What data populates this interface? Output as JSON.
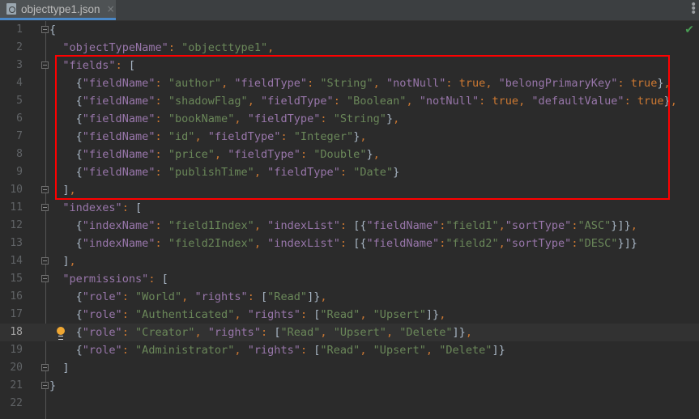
{
  "tab": {
    "filename": "objecttype1.json",
    "close": "×",
    "icon": "json-file-icon"
  },
  "toolbar": {
    "menu_icon": "more-vertical-icon",
    "status_icon": "check-icon"
  },
  "current_line": 18,
  "fold_lines": [
    1,
    3,
    10,
    11,
    14,
    15,
    20,
    21
  ],
  "bulb_line": 18,
  "highlight": {
    "label": "fields",
    "color": "#ff0000"
  },
  "lines": [
    [
      [
        "br",
        "{"
      ]
    ],
    [
      [
        "sp",
        "  "
      ],
      [
        "key",
        "\"objectTypeName\""
      ],
      [
        "punc",
        ": "
      ],
      [
        "str",
        "\"objecttype1\""
      ],
      [
        "punc",
        ","
      ]
    ],
    [
      [
        "sp",
        "  "
      ],
      [
        "key",
        "\"fields\""
      ],
      [
        "punc",
        ": "
      ],
      [
        "br",
        "["
      ]
    ],
    [
      [
        "sp",
        "    "
      ],
      [
        "br",
        "{"
      ],
      [
        "key",
        "\"fieldName\""
      ],
      [
        "punc",
        ": "
      ],
      [
        "str",
        "\"author\""
      ],
      [
        "punc",
        ", "
      ],
      [
        "key",
        "\"fieldType\""
      ],
      [
        "punc",
        ": "
      ],
      [
        "str",
        "\"String\""
      ],
      [
        "punc",
        ", "
      ],
      [
        "key",
        "\"notNull\""
      ],
      [
        "punc",
        ": "
      ],
      [
        "kw",
        "true"
      ],
      [
        "punc",
        ", "
      ],
      [
        "key",
        "\"belongPrimaryKey\""
      ],
      [
        "punc",
        ": "
      ],
      [
        "kw",
        "true"
      ],
      [
        "br",
        "}"
      ],
      [
        "punc",
        ","
      ]
    ],
    [
      [
        "sp",
        "    "
      ],
      [
        "br",
        "{"
      ],
      [
        "key",
        "\"fieldName\""
      ],
      [
        "punc",
        ": "
      ],
      [
        "str",
        "\"shadowFlag\""
      ],
      [
        "punc",
        ", "
      ],
      [
        "key",
        "\"fieldType\""
      ],
      [
        "punc",
        ": "
      ],
      [
        "str",
        "\"Boolean\""
      ],
      [
        "punc",
        ", "
      ],
      [
        "key",
        "\"notNull\""
      ],
      [
        "punc",
        ": "
      ],
      [
        "kw",
        "true"
      ],
      [
        "punc",
        ", "
      ],
      [
        "key",
        "\"defaultValue\""
      ],
      [
        "punc",
        ": "
      ],
      [
        "kw",
        "true"
      ],
      [
        "br",
        "}"
      ],
      [
        "punc",
        ","
      ]
    ],
    [
      [
        "sp",
        "    "
      ],
      [
        "br",
        "{"
      ],
      [
        "key",
        "\"fieldName\""
      ],
      [
        "punc",
        ": "
      ],
      [
        "str",
        "\"bookName\""
      ],
      [
        "punc",
        ", "
      ],
      [
        "key",
        "\"fieldType\""
      ],
      [
        "punc",
        ": "
      ],
      [
        "str",
        "\"String\""
      ],
      [
        "br",
        "}"
      ],
      [
        "punc",
        ","
      ]
    ],
    [
      [
        "sp",
        "    "
      ],
      [
        "br",
        "{"
      ],
      [
        "key",
        "\"fieldName\""
      ],
      [
        "punc",
        ": "
      ],
      [
        "str",
        "\"id\""
      ],
      [
        "punc",
        ", "
      ],
      [
        "key",
        "\"fieldType\""
      ],
      [
        "punc",
        ": "
      ],
      [
        "str",
        "\"Integer\""
      ],
      [
        "br",
        "}"
      ],
      [
        "punc",
        ","
      ]
    ],
    [
      [
        "sp",
        "    "
      ],
      [
        "br",
        "{"
      ],
      [
        "key",
        "\"fieldName\""
      ],
      [
        "punc",
        ": "
      ],
      [
        "str",
        "\"price\""
      ],
      [
        "punc",
        ", "
      ],
      [
        "key",
        "\"fieldType\""
      ],
      [
        "punc",
        ": "
      ],
      [
        "str",
        "\"Double\""
      ],
      [
        "br",
        "}"
      ],
      [
        "punc",
        ","
      ]
    ],
    [
      [
        "sp",
        "    "
      ],
      [
        "br",
        "{"
      ],
      [
        "key",
        "\"fieldName\""
      ],
      [
        "punc",
        ": "
      ],
      [
        "str",
        "\"publishTime\""
      ],
      [
        "punc",
        ", "
      ],
      [
        "key",
        "\"fieldType\""
      ],
      [
        "punc",
        ": "
      ],
      [
        "str",
        "\"Date\""
      ],
      [
        "br",
        "}"
      ]
    ],
    [
      [
        "sp",
        "  "
      ],
      [
        "br",
        "]"
      ],
      [
        "punc",
        ","
      ]
    ],
    [
      [
        "sp",
        "  "
      ],
      [
        "key",
        "\"indexes\""
      ],
      [
        "punc",
        ": "
      ],
      [
        "br",
        "["
      ]
    ],
    [
      [
        "sp",
        "    "
      ],
      [
        "br",
        "{"
      ],
      [
        "key",
        "\"indexName\""
      ],
      [
        "punc",
        ": "
      ],
      [
        "str",
        "\"field1Index\""
      ],
      [
        "punc",
        ", "
      ],
      [
        "key",
        "\"indexList\""
      ],
      [
        "punc",
        ": "
      ],
      [
        "br",
        "[{"
      ],
      [
        "key",
        "\"fieldName\""
      ],
      [
        "punc",
        ":"
      ],
      [
        "str",
        "\"field1\""
      ],
      [
        "punc",
        ","
      ],
      [
        "key",
        "\"sortType\""
      ],
      [
        "punc",
        ":"
      ],
      [
        "str",
        "\"ASC\""
      ],
      [
        "br",
        "}]}"
      ],
      [
        "punc",
        ","
      ]
    ],
    [
      [
        "sp",
        "    "
      ],
      [
        "br",
        "{"
      ],
      [
        "key",
        "\"indexName\""
      ],
      [
        "punc",
        ": "
      ],
      [
        "str",
        "\"field2Index\""
      ],
      [
        "punc",
        ", "
      ],
      [
        "key",
        "\"indexList\""
      ],
      [
        "punc",
        ": "
      ],
      [
        "br",
        "[{"
      ],
      [
        "key",
        "\"fieldName\""
      ],
      [
        "punc",
        ":"
      ],
      [
        "str",
        "\"field2\""
      ],
      [
        "punc",
        ","
      ],
      [
        "key",
        "\"sortType\""
      ],
      [
        "punc",
        ":"
      ],
      [
        "str",
        "\"DESC\""
      ],
      [
        "br",
        "}]}"
      ]
    ],
    [
      [
        "sp",
        "  "
      ],
      [
        "br",
        "]"
      ],
      [
        "punc",
        ","
      ]
    ],
    [
      [
        "sp",
        "  "
      ],
      [
        "key",
        "\"permissions\""
      ],
      [
        "punc",
        ": "
      ],
      [
        "br",
        "["
      ]
    ],
    [
      [
        "sp",
        "    "
      ],
      [
        "br",
        "{"
      ],
      [
        "key",
        "\"role\""
      ],
      [
        "punc",
        ": "
      ],
      [
        "str",
        "\"World\""
      ],
      [
        "punc",
        ", "
      ],
      [
        "key",
        "\"rights\""
      ],
      [
        "punc",
        ": "
      ],
      [
        "br",
        "["
      ],
      [
        "str",
        "\"Read\""
      ],
      [
        "br",
        "]}"
      ],
      [
        "punc",
        ","
      ]
    ],
    [
      [
        "sp",
        "    "
      ],
      [
        "br",
        "{"
      ],
      [
        "key",
        "\"role\""
      ],
      [
        "punc",
        ": "
      ],
      [
        "str",
        "\"Authenticated\""
      ],
      [
        "punc",
        ", "
      ],
      [
        "key",
        "\"rights\""
      ],
      [
        "punc",
        ": "
      ],
      [
        "br",
        "["
      ],
      [
        "str",
        "\"Read\""
      ],
      [
        "punc",
        ", "
      ],
      [
        "str",
        "\"Upsert\""
      ],
      [
        "br",
        "]}"
      ],
      [
        "punc",
        ","
      ]
    ],
    [
      [
        "sp",
        "    "
      ],
      [
        "br",
        "{"
      ],
      [
        "key",
        "\"role\""
      ],
      [
        "punc",
        ": "
      ],
      [
        "str",
        "\"Creator\""
      ],
      [
        "punc",
        ", "
      ],
      [
        "key",
        "\"rights\""
      ],
      [
        "punc",
        ": "
      ],
      [
        "br",
        "["
      ],
      [
        "str",
        "\"Read\""
      ],
      [
        "punc",
        ", "
      ],
      [
        "str",
        "\"Upsert\""
      ],
      [
        "punc",
        ", "
      ],
      [
        "str",
        "\"Delete\""
      ],
      [
        "br",
        "]}"
      ],
      [
        "punc",
        ","
      ]
    ],
    [
      [
        "sp",
        "    "
      ],
      [
        "br",
        "{"
      ],
      [
        "key",
        "\"role\""
      ],
      [
        "punc",
        ": "
      ],
      [
        "str",
        "\"Administrator\""
      ],
      [
        "punc",
        ", "
      ],
      [
        "key",
        "\"rights\""
      ],
      [
        "punc",
        ": "
      ],
      [
        "br",
        "["
      ],
      [
        "str",
        "\"Read\""
      ],
      [
        "punc",
        ", "
      ],
      [
        "str",
        "\"Upsert\""
      ],
      [
        "punc",
        ", "
      ],
      [
        "str",
        "\"Delete\""
      ],
      [
        "br",
        "]}"
      ]
    ],
    [
      [
        "sp",
        "  "
      ],
      [
        "br",
        "]"
      ]
    ],
    [
      [
        "br",
        "}"
      ]
    ],
    []
  ]
}
